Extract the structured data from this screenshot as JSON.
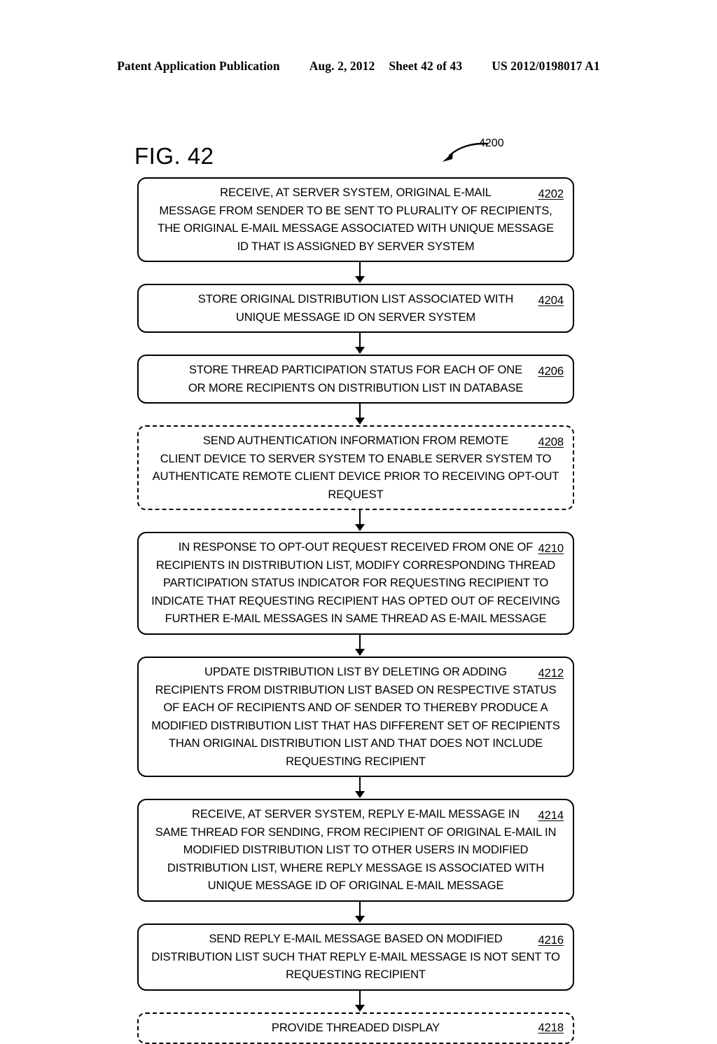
{
  "header": {
    "publication": "Patent Application Publication",
    "date": "Aug. 2, 2012",
    "sheet": "Sheet 42 of 43",
    "number": "US 2012/0198017 A1"
  },
  "figure": {
    "title": "FIG. 42",
    "callout_ref": "4200"
  },
  "flow": {
    "nodes": [
      {
        "ref": "4202",
        "style": "solid",
        "text": "RECEIVE, AT SERVER SYSTEM, ORIGINAL E-MAIL\nMESSAGE FROM SENDER TO BE SENT TO PLURALITY OF RECIPIENTS,\nTHE ORIGINAL E-MAIL MESSAGE ASSOCIATED WITH UNIQUE MESSAGE\nID THAT IS ASSIGNED BY SERVER SYSTEM"
      },
      {
        "ref": "4204",
        "style": "solid",
        "text": "STORE ORIGINAL DISTRIBUTION LIST ASSOCIATED WITH\nUNIQUE MESSAGE ID ON SERVER SYSTEM"
      },
      {
        "ref": "4206",
        "style": "solid",
        "text": "STORE THREAD PARTICIPATION STATUS FOR EACH OF ONE\nOR MORE RECIPIENTS ON DISTRIBUTION LIST IN DATABASE"
      },
      {
        "ref": "4208",
        "style": "dotted",
        "text": "SEND AUTHENTICATION INFORMATION FROM REMOTE\nCLIENT DEVICE TO SERVER SYSTEM TO ENABLE SERVER SYSTEM TO\nAUTHENTICATE REMOTE CLIENT DEVICE PRIOR TO RECEIVING OPT-OUT\nREQUEST"
      },
      {
        "ref": "4210",
        "style": "solid",
        "text": "IN RESPONSE TO OPT-OUT REQUEST RECEIVED FROM ONE OF\nRECIPIENTS IN DISTRIBUTION LIST, MODIFY CORRESPONDING THREAD\nPARTICIPATION STATUS INDICATOR FOR REQUESTING RECIPIENT TO\nINDICATE THAT REQUESTING RECIPIENT HAS OPTED OUT OF RECEIVING\nFURTHER E-MAIL MESSAGES IN SAME THREAD AS E-MAIL MESSAGE"
      },
      {
        "ref": "4212",
        "style": "solid",
        "text": "UPDATE DISTRIBUTION LIST BY DELETING OR ADDING\nRECIPIENTS FROM DISTRIBUTION LIST BASED ON RESPECTIVE STATUS\nOF EACH OF RECIPIENTS AND OF SENDER TO THEREBY PRODUCE A\nMODIFIED DISTRIBUTION LIST THAT HAS DIFFERENT SET OF RECIPIENTS\nTHAN ORIGINAL DISTRIBUTION LIST AND THAT DOES NOT INCLUDE\nREQUESTING RECIPIENT"
      },
      {
        "ref": "4214",
        "style": "solid",
        "text": "RECEIVE, AT SERVER SYSTEM, REPLY E-MAIL MESSAGE IN\nSAME THREAD FOR SENDING, FROM RECIPIENT OF ORIGINAL E-MAIL IN\nMODIFIED DISTRIBUTION LIST TO OTHER USERS IN MODIFIED\nDISTRIBUTION LIST, WHERE REPLY MESSAGE IS ASSOCIATED WITH\nUNIQUE MESSAGE ID OF ORIGINAL E-MAIL MESSAGE"
      },
      {
        "ref": "4216",
        "style": "solid",
        "text": "SEND REPLY E-MAIL MESSAGE BASED ON MODIFIED\nDISTRIBUTION LIST SUCH THAT REPLY E-MAIL MESSAGE IS NOT SENT TO\nREQUESTING RECIPIENT"
      },
      {
        "ref": "4218",
        "style": "dashed",
        "text": "PROVIDE THREADED DISPLAY"
      }
    ]
  }
}
